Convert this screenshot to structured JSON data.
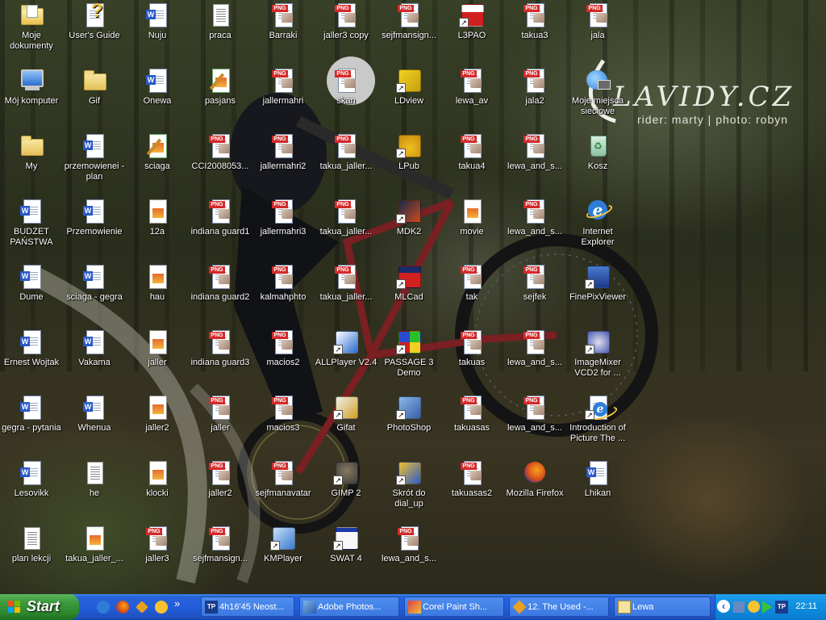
{
  "desktop": {
    "background": "Mountain bike rider wallpaper",
    "wallpaper_text": {
      "signature": "LAVIDY.CZ",
      "credit": "rider: marty | photo: robyn"
    },
    "icons": [
      {
        "id": "moje-dokumenty",
        "label": "Moje dokumenty",
        "type": "folder-docs"
      },
      {
        "id": "users-guide",
        "label": "User's Guide",
        "type": "help"
      },
      {
        "id": "nuju",
        "label": "Nuju",
        "type": "word"
      },
      {
        "id": "praca",
        "label": "praca",
        "type": "text"
      },
      {
        "id": "barraki",
        "label": "Barraki",
        "type": "png"
      },
      {
        "id": "jaller3-copy",
        "label": "jaller3 copy",
        "type": "png"
      },
      {
        "id": "sejfmansign1",
        "label": "sejfmansign...",
        "type": "png"
      },
      {
        "id": "l3pao",
        "label": "L3PAO",
        "type": "app-l3pao"
      },
      {
        "id": "takua3",
        "label": "takua3",
        "type": "png"
      },
      {
        "id": "jala",
        "label": "jala",
        "type": "png"
      },
      {
        "id": "moj-komputer",
        "label": "Mój komputer",
        "type": "computer"
      },
      {
        "id": "gif",
        "label": "Gif",
        "type": "folder"
      },
      {
        "id": "onewa",
        "label": "Onewa",
        "type": "word"
      },
      {
        "id": "pasjans",
        "label": "pasjans",
        "type": "paint"
      },
      {
        "id": "jallermahri",
        "label": "jallermahri",
        "type": "png"
      },
      {
        "id": "skan",
        "label": "skan",
        "type": "png"
      },
      {
        "id": "ldview",
        "label": "LDview",
        "type": "app-ldview"
      },
      {
        "id": "lewa-av",
        "label": "lewa_av",
        "type": "png"
      },
      {
        "id": "jala2",
        "label": "jala2",
        "type": "png"
      },
      {
        "id": "moje-miejsca",
        "label": "Moje miejsca sieciowe",
        "type": "network"
      },
      {
        "id": "my",
        "label": "My",
        "type": "folder"
      },
      {
        "id": "przemowienei",
        "label": "przemowienei - plan",
        "type": "word"
      },
      {
        "id": "sciaga",
        "label": "sciaga",
        "type": "paint"
      },
      {
        "id": "cci2008053",
        "label": "CCI2008053...",
        "type": "png"
      },
      {
        "id": "jallermahri2",
        "label": "jallermahri2",
        "type": "png"
      },
      {
        "id": "takua-jaller-1",
        "label": "takua_jaller...",
        "type": "png"
      },
      {
        "id": "lpub",
        "label": "LPub",
        "type": "app-lpub"
      },
      {
        "id": "takua4",
        "label": "takua4",
        "type": "png"
      },
      {
        "id": "lewa-and-s-1",
        "label": "lewa_and_s...",
        "type": "png"
      },
      {
        "id": "kosz",
        "label": "Kosz",
        "type": "recycle"
      },
      {
        "id": "budzet",
        "label": "BUDŻET PAŃSTWA",
        "type": "word"
      },
      {
        "id": "przemowienie",
        "label": "Przemowienie",
        "type": "word"
      },
      {
        "id": "12a",
        "label": "12a",
        "type": "jpg"
      },
      {
        "id": "indiana-guard1",
        "label": "indiana guard1",
        "type": "png"
      },
      {
        "id": "jallermahri3",
        "label": "jallermahri3",
        "type": "png"
      },
      {
        "id": "takua-jaller-2",
        "label": "takua_jaller...",
        "type": "png"
      },
      {
        "id": "mdk2",
        "label": "MDK2",
        "type": "app-mdk"
      },
      {
        "id": "movie",
        "label": "movie",
        "type": "jpg"
      },
      {
        "id": "lewa-and-s-2",
        "label": "lewa_and_s...",
        "type": "png"
      },
      {
        "id": "internet-explorer",
        "label": "Internet Explorer",
        "type": "ie"
      },
      {
        "id": "dume",
        "label": "Dume",
        "type": "word"
      },
      {
        "id": "sciaga-gegra",
        "label": "sciaga - gegra",
        "type": "word"
      },
      {
        "id": "hau",
        "label": "hau",
        "type": "jpg"
      },
      {
        "id": "indiana-guard2",
        "label": "indiana guard2",
        "type": "png"
      },
      {
        "id": "kalmahphto",
        "label": "kalmahphto",
        "type": "png"
      },
      {
        "id": "takua-jaller-3",
        "label": "takua_jaller...",
        "type": "png"
      },
      {
        "id": "mlcad",
        "label": "MLCad",
        "type": "app-mlcad"
      },
      {
        "id": "tak",
        "label": "tak",
        "type": "png"
      },
      {
        "id": "sejfek",
        "label": "sejfek",
        "type": "png"
      },
      {
        "id": "finepixviewer",
        "label": "FinePixViewer",
        "type": "app-finepix"
      },
      {
        "id": "ernest-wojtak",
        "label": "Ernest Wojtak",
        "type": "word"
      },
      {
        "id": "vakama",
        "label": "Vakama",
        "type": "word"
      },
      {
        "id": "jaller",
        "label": "jaller",
        "type": "jpg"
      },
      {
        "id": "indiana-guard3",
        "label": "indiana guard3",
        "type": "png"
      },
      {
        "id": "macios2",
        "label": "macios2",
        "type": "png"
      },
      {
        "id": "allplayer",
        "label": "ALLPlayer V2.4",
        "type": "app-allplayer"
      },
      {
        "id": "passage3",
        "label": "PASSAGE 3 Demo",
        "type": "app-passage"
      },
      {
        "id": "takuas",
        "label": "takuas",
        "type": "png"
      },
      {
        "id": "lewa-and-s-3",
        "label": "lewa_and_s...",
        "type": "png"
      },
      {
        "id": "imagemixer",
        "label": "ImageMixer VCD2 for ...",
        "type": "app-imagemixer"
      },
      {
        "id": "gegra-pytania",
        "label": "gegra - pytania",
        "type": "word"
      },
      {
        "id": "whenua",
        "label": "Whenua",
        "type": "word"
      },
      {
        "id": "jaller2-jpg",
        "label": "jaller2",
        "type": "jpg"
      },
      {
        "id": "jaller-png",
        "label": "jaller",
        "type": "png"
      },
      {
        "id": "macios3",
        "label": "macios3",
        "type": "png"
      },
      {
        "id": "gifat",
        "label": "Gifat",
        "type": "app-gifat"
      },
      {
        "id": "photoshop",
        "label": "PhotoShop",
        "type": "app-photoshop"
      },
      {
        "id": "takuasas",
        "label": "takuasas",
        "type": "png"
      },
      {
        "id": "lewa-and-s-4",
        "label": "lewa_and_s...",
        "type": "png"
      },
      {
        "id": "intro-picture",
        "label": "Introduction of Picture The ...",
        "type": "ie-doc"
      },
      {
        "id": "lesovikk",
        "label": "Lesovikk",
        "type": "word"
      },
      {
        "id": "he",
        "label": "he",
        "type": "text"
      },
      {
        "id": "klocki",
        "label": "klocki",
        "type": "jpg"
      },
      {
        "id": "jaller2-png",
        "label": "jaller2",
        "type": "png"
      },
      {
        "id": "sejfmanavatar",
        "label": "sejfmanavatar",
        "type": "png"
      },
      {
        "id": "gimp2",
        "label": "GIMP 2",
        "type": "app-gimp"
      },
      {
        "id": "skrot-dial-up",
        "label": "Skrót do dial_up",
        "type": "app-dialup"
      },
      {
        "id": "takuasas2",
        "label": "takuasas2",
        "type": "png"
      },
      {
        "id": "mozilla-firefox",
        "label": "Mozilla Firefox",
        "type": "firefox"
      },
      {
        "id": "lhikan",
        "label": "Lhikan",
        "type": "word"
      },
      {
        "id": "plan-lekcji",
        "label": "plan lekcji",
        "type": "text"
      },
      {
        "id": "takua-jaller-jpg",
        "label": "takua_jaller_...",
        "type": "jpg"
      },
      {
        "id": "jaller3",
        "label": "jaller3",
        "type": "png"
      },
      {
        "id": "sejfmansign2",
        "label": "sejfmansign...",
        "type": "png"
      },
      {
        "id": "kmplayer",
        "label": "KMPlayer",
        "type": "app-kmplayer"
      },
      {
        "id": "swat4",
        "label": "SWAT 4",
        "type": "app-swat"
      },
      {
        "id": "lewa-and-s-5",
        "label": "lewa_and_s...",
        "type": "png"
      }
    ]
  },
  "taskbar": {
    "start_label": "Start",
    "quick_launch": [
      "ie",
      "firefox",
      "winamp",
      "gifat"
    ],
    "overflow": "»",
    "buttons": [
      {
        "label": "4h16'45 Neost...",
        "icon": "TP"
      },
      {
        "label": "Adobe Photos...",
        "icon": "ps"
      },
      {
        "label": "Corel Paint Sh...",
        "icon": "corel"
      },
      {
        "label": "12. The Used -...",
        "icon": "winamp"
      },
      {
        "label": "Lewa",
        "icon": "mail"
      }
    ],
    "tray": {
      "time": "22:11",
      "collapse_glyph": "‹"
    }
  },
  "colors": {
    "taskbar": "#245ddb",
    "start": "#3d9a3d",
    "tray": "#1090e0",
    "label": "#ffffff"
  }
}
